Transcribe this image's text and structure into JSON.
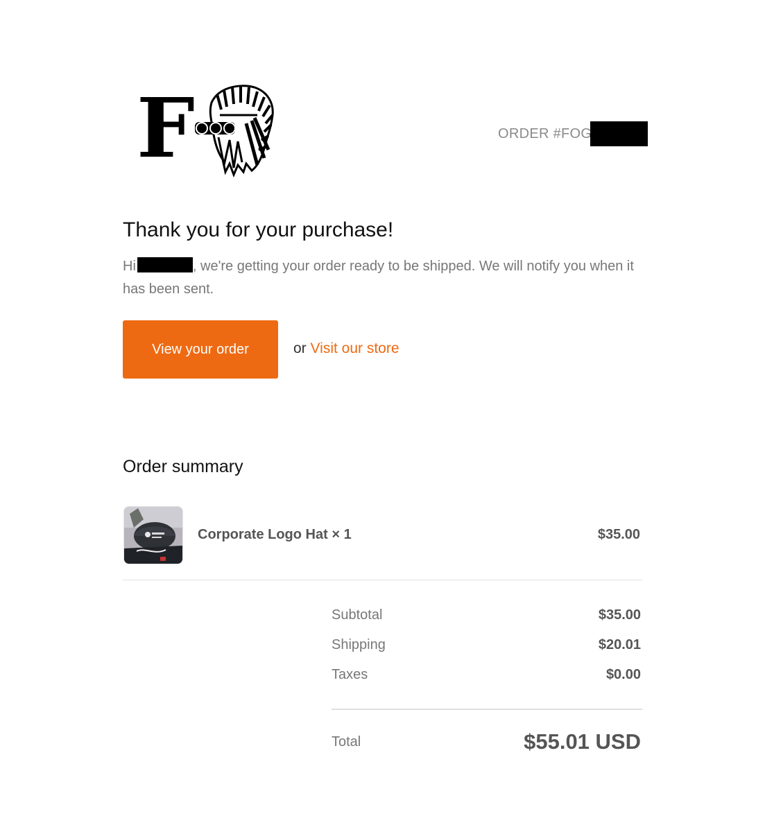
{
  "header": {
    "logo_text": "F",
    "order_number": "ORDER #FOG"
  },
  "main": {
    "title": "Thank you for your purchase!",
    "greeting_prefix": "Hi",
    "message": ", we're getting your order ready to be shipped. We will notify you when it has been sent.",
    "view_order_label": "View your order",
    "or_text": "or",
    "visit_store_label": "Visit our store"
  },
  "summary": {
    "title": "Order summary",
    "items": [
      {
        "name": "Corporate Logo Hat × 1",
        "price": "$35.00",
        "thumbnail_icon": "hat-product-photo"
      }
    ],
    "subtotal_label": "Subtotal",
    "subtotal_value": "$35.00",
    "shipping_label": "Shipping",
    "shipping_value": "$20.01",
    "taxes_label": "Taxes",
    "taxes_value": "$0.00",
    "total_label": "Total",
    "total_value": "$55.01 USD"
  },
  "colors": {
    "accent": "#ee6a12",
    "muted_text": "#777777",
    "redaction": "#000000"
  }
}
